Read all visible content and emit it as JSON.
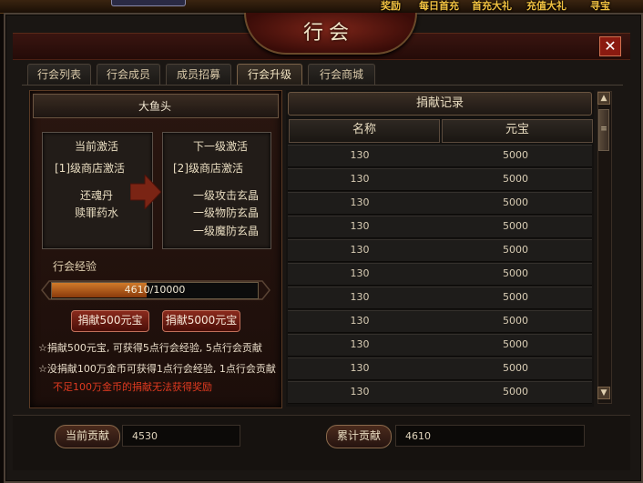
{
  "banner": {
    "items": [
      "奖励",
      "每日首充",
      "首充大礼",
      "充值大礼",
      "寻宝"
    ]
  },
  "window": {
    "title": "行会",
    "close_label": "✕"
  },
  "tabs": [
    {
      "label": "行会列表"
    },
    {
      "label": "行会成员"
    },
    {
      "label": "成员招募"
    },
    {
      "label": "行会升级",
      "active": true
    },
    {
      "label": "行会商城"
    }
  ],
  "upgrade": {
    "guild_name": "大鱼头",
    "current": {
      "title": "当前激活",
      "shop": "[1]级商店激活",
      "items": [
        "还魂丹",
        "赎罪药水"
      ]
    },
    "next": {
      "title": "下一级激活",
      "shop": "[2]级商店激活",
      "items": [
        "一级攻击玄晶",
        "一级物防玄晶",
        "一级魔防玄晶"
      ]
    },
    "exp_label": "行会经验",
    "exp_text": "4610/10000",
    "exp_fraction": 0.461,
    "donate_500": "捐献500元宝",
    "donate_5000": "捐献5000元宝",
    "note_1": "☆捐献500元宝, 可获得5点行会经验, 5点行会贡献",
    "note_2": "☆没捐献100万金币可获得1点行会经验, 1点行会贡献",
    "note_3": "不足100万金币的捐献无法获得奖励"
  },
  "records": {
    "title": "捐献记录",
    "col_name": "名称",
    "col_ingot": "元宝",
    "rows": [
      {
        "name": "130",
        "ingot": "5000"
      },
      {
        "name": "130",
        "ingot": "5000"
      },
      {
        "name": "130",
        "ingot": "5000"
      },
      {
        "name": "130",
        "ingot": "5000"
      },
      {
        "name": "130",
        "ingot": "5000"
      },
      {
        "name": "130",
        "ingot": "5000"
      },
      {
        "name": "130",
        "ingot": "5000"
      },
      {
        "name": "130",
        "ingot": "5000"
      },
      {
        "name": "130",
        "ingot": "5000"
      },
      {
        "name": "130",
        "ingot": "5000"
      },
      {
        "name": "130",
        "ingot": "5000"
      }
    ]
  },
  "footer": {
    "current_label": "当前贡献",
    "current_value": "4530",
    "total_label": "累计贡献",
    "total_value": "4610"
  },
  "colors": {
    "exp_fill": "#d07a2a",
    "accent_red": "#e03a20",
    "close": "#8a1a10"
  }
}
